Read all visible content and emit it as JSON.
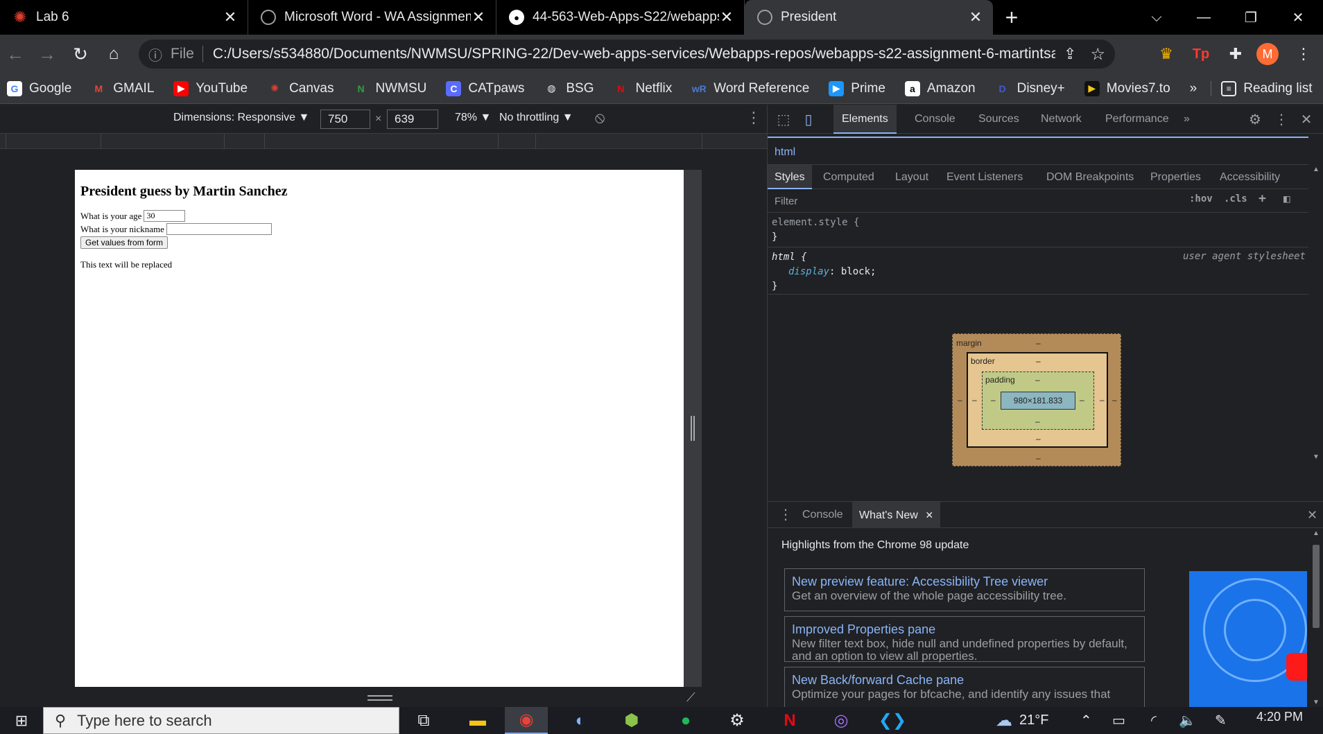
{
  "browser": {
    "tabs": [
      {
        "title": "Lab 6",
        "icon": "canvas-icon",
        "color": "#e03e2d"
      },
      {
        "title": "Microsoft Word - WA Assignmen",
        "icon": "globe-icon",
        "color": "#9aa0a6"
      },
      {
        "title": "44-563-Web-Apps-S22/webapps",
        "icon": "github-icon",
        "color": "#ffffff"
      },
      {
        "title": "President",
        "icon": "globe-icon",
        "color": "#9aa0a6",
        "active": true
      }
    ],
    "close_glyph": "✕",
    "new_tab_glyph": "+",
    "window_controls": {
      "dropdown": "⌵",
      "minimize": "—",
      "restore": "❐",
      "close": "✕"
    },
    "address": {
      "scheme": "File",
      "url": "C:/Users/s534880/Documents/NWMSU/SPRING-22/Dev-web-apps-services/Webapps-repos/webapps-s22-assignment-6-martintsan..."
    },
    "profile_initial": "M",
    "bookmarks": [
      {
        "label": "Google",
        "icon": "google-icon",
        "glyph": "G",
        "color": "#ffffff",
        "fg": "#4285f4"
      },
      {
        "label": "GMAIL",
        "icon": "gmail-icon",
        "glyph": "M",
        "color": "transparent",
        "fg": "#ea4335"
      },
      {
        "label": "YouTube",
        "icon": "youtube-icon",
        "glyph": "▶",
        "color": "#ff0000",
        "fg": "#ffffff"
      },
      {
        "label": "Canvas",
        "icon": "canvas-icon",
        "glyph": "✺",
        "color": "transparent",
        "fg": "#e03e2d"
      },
      {
        "label": "NWMSU",
        "icon": "nwmsu-icon",
        "glyph": "N",
        "color": "transparent",
        "fg": "#2ea043"
      },
      {
        "label": "CATpaws",
        "icon": "catpaws-icon",
        "glyph": "C",
        "color": "#5b6bff",
        "fg": "#ffffff"
      },
      {
        "label": "BSG",
        "icon": "globe-icon",
        "glyph": "◍",
        "color": "transparent",
        "fg": "#e8eaed"
      },
      {
        "label": "Netflix",
        "icon": "netflix-icon",
        "glyph": "N",
        "color": "transparent",
        "fg": "#e50914"
      },
      {
        "label": "Word Reference",
        "icon": "wordreference-icon",
        "glyph": "wR",
        "color": "transparent",
        "fg": "#4a7bd0"
      },
      {
        "label": "Prime",
        "icon": "prime-icon",
        "glyph": "▶",
        "color": "#1a98ff",
        "fg": "#ffffff"
      },
      {
        "label": "Amazon",
        "icon": "amazon-icon",
        "glyph": "a",
        "color": "#ffffff",
        "fg": "#000000"
      },
      {
        "label": "Disney+",
        "icon": "disney-icon",
        "glyph": "D",
        "color": "transparent",
        "fg": "#3b5bdb"
      },
      {
        "label": "Movies7.to",
        "icon": "movies-icon",
        "glyph": "▶",
        "color": "#111111",
        "fg": "#f5c518"
      }
    ],
    "bookmarks_more": "»",
    "reading_list": "Reading list"
  },
  "device_toolbar": {
    "dimensions": "Dimensions: Responsive ▼",
    "width": "750",
    "times": "×",
    "height": "639",
    "zoom": "78% ▼",
    "throttling": "No throttling ▼"
  },
  "page": {
    "heading": "President guess by Martin Sanchez",
    "age_label": "What is your age",
    "age_value": "30",
    "nickname_label": "What is your nickname",
    "nickname_value": "",
    "button_label": "Get values from form",
    "output_text": "This text will be replaced"
  },
  "devtools": {
    "tabs": [
      "Elements",
      "Console",
      "Sources",
      "Network",
      "Performance"
    ],
    "more_tabs": "»",
    "breadcrumb": "html",
    "sub_tabs": [
      "Styles",
      "Computed",
      "Layout",
      "Event Listeners",
      "DOM Breakpoints",
      "Properties",
      "Accessibility"
    ],
    "filter_placeholder": "Filter",
    "hov": ":hov",
    "cls": ".cls",
    "rules": {
      "element_style_open": "element.style {",
      "close_brace": "}",
      "html_selector": "html {",
      "html_source": "user agent stylesheet",
      "html_prop": "display",
      "html_value": "block;"
    },
    "box_model": {
      "margin_label": "margin",
      "border_label": "border",
      "padding_label": "padding",
      "dash": "–",
      "content_size": "980×181.833"
    },
    "drawer": {
      "tabs": [
        "Console",
        "What's New"
      ],
      "headline": "Highlights from the Chrome 98 update",
      "cards": [
        {
          "title": "New preview feature: Accessibility Tree viewer",
          "desc": "Get an overview of the whole page accessibility tree."
        },
        {
          "title": "Improved Properties pane",
          "desc": "New filter text box, hide null and undefined properties by default, and an option to view all properties."
        },
        {
          "title": "New Back/forward Cache pane",
          "desc": "Optimize your pages for bfcache, and identify any issues that"
        }
      ]
    }
  },
  "taskbar": {
    "search_placeholder": "Type here to search",
    "weather": "21°F",
    "time": "4:20 PM"
  }
}
